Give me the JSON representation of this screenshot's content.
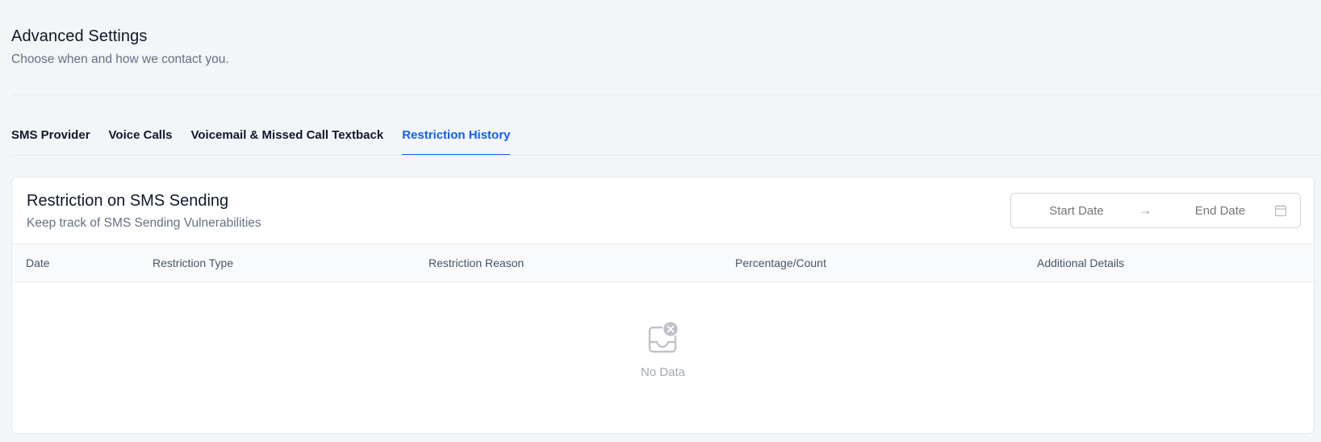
{
  "header": {
    "title": "Advanced Settings",
    "subtitle": "Choose when and how we contact you."
  },
  "tabs": [
    {
      "label": "SMS Provider",
      "active": false
    },
    {
      "label": "Voice Calls",
      "active": false
    },
    {
      "label": "Voicemail & Missed Call Textback",
      "active": false
    },
    {
      "label": "Restriction History",
      "active": true
    }
  ],
  "card": {
    "title": "Restriction on SMS Sending",
    "subtitle": "Keep track of SMS Sending Vulnerabilities",
    "date_range": {
      "start_placeholder": "Start Date",
      "end_placeholder": "End Date",
      "arrow": "→",
      "calendar_icon": "calendar-icon"
    },
    "table": {
      "columns": [
        "Date",
        "Restriction Type",
        "Restriction Reason",
        "Percentage/Count",
        "Additional Details"
      ],
      "rows": []
    },
    "empty_state": {
      "text": "No Data",
      "icon": "empty-inbox-icon"
    }
  },
  "colors": {
    "accent": "#155eef",
    "page_background": "#f2f6f8",
    "muted_text": "#667085"
  }
}
